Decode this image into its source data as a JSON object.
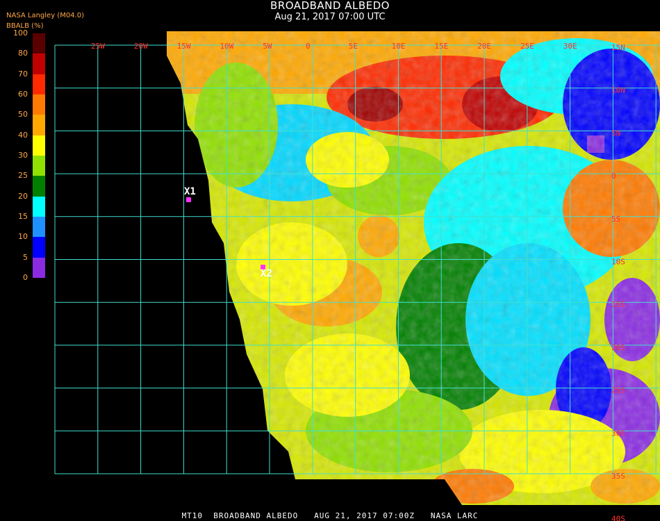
{
  "header": {
    "title": "BROADBAND ALBEDO",
    "subtitle": "Aug 21, 2017 07:00 UTC",
    "org": "NASA Langley (M04.0)",
    "unit_label": "BBALB (%)"
  },
  "colorbar": {
    "ticks": [
      "100",
      "80",
      "70",
      "60",
      "50",
      "40",
      "30",
      "25",
      "20",
      "15",
      "10",
      "5",
      "0"
    ],
    "colors": [
      "#5a0000",
      "#c00000",
      "#ff2a00",
      "#ff7a00",
      "#ffa800",
      "#ffff00",
      "#90e000",
      "#008000",
      "#00ffff",
      "#1e90ff",
      "#0000ff",
      "#8a2be2"
    ]
  },
  "map": {
    "lon_labels": [
      "25W",
      "20W",
      "15W",
      "10W",
      "5W",
      "0",
      "5E",
      "10E",
      "15E",
      "20E",
      "25E",
      "30E"
    ],
    "lat_labels": [
      "15N",
      "10N",
      "5N",
      "0",
      "5S",
      "10S",
      "15S",
      "20S",
      "25S",
      "30S",
      "35S",
      "40S"
    ],
    "markers": [
      {
        "label": "X1",
        "color": "#ff33ff"
      },
      {
        "label": "X2",
        "color": "#ff33ff"
      }
    ],
    "grid_color": "#40e0d0"
  },
  "footer": {
    "text": "MT10  BROADBAND ALBEDO   AUG 21, 2017 07:00Z   NASA LARC"
  }
}
